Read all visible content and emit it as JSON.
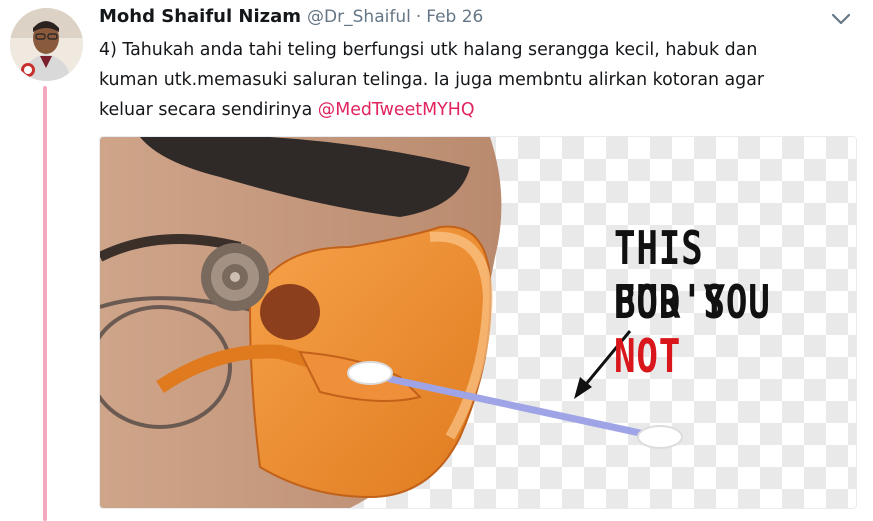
{
  "tweet": {
    "author_name": "Mohd Shaiful Nizam",
    "handle": "@Dr_Shaiful",
    "separator": "·",
    "date": "Feb 26",
    "text_lines": [
      "4) Tahukah anda tahi teling berfungsi utk halang serangga kecil, habuk dan",
      "kuman utk.memasuki saluran telinga. Ia juga membntu alirkan kotoran agar",
      "keluar secara sendirinya "
    ],
    "mention": "@MedTweetMYHQ"
  },
  "image": {
    "caption_line1_a": "THIS BUD'S ",
    "caption_line1_b": "NOT",
    "caption_line2": "FOR YOU"
  },
  "colors": {
    "thread_line": "#f3a9bd",
    "mention": "#e0245e",
    "muted": "#657786"
  },
  "icons": {
    "menu": "chevron-down-icon"
  }
}
